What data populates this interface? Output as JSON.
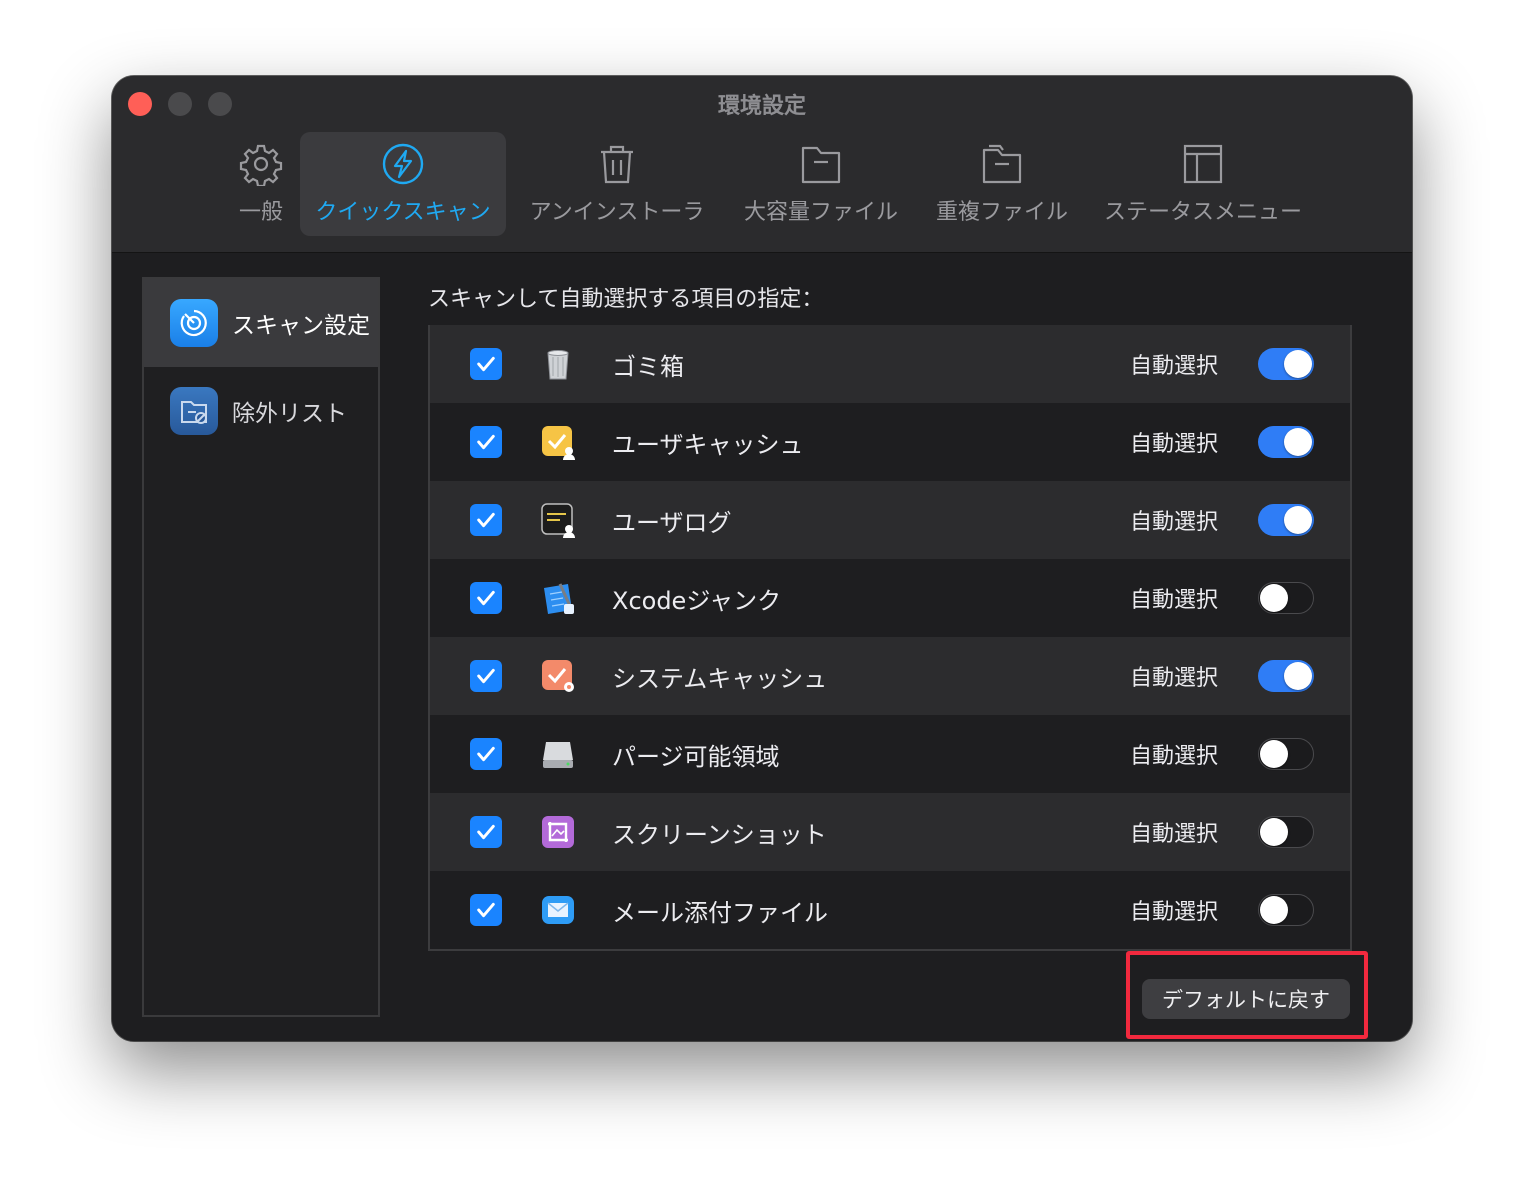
{
  "window": {
    "title": "環境設定"
  },
  "toolbar": {
    "tabs": [
      {
        "label": "一般",
        "icon": "gear-icon",
        "active": false
      },
      {
        "label": "クイックスキャン",
        "icon": "lightning-icon",
        "active": true
      },
      {
        "label": "アンインストーラ",
        "icon": "trash-icon",
        "active": false
      },
      {
        "label": "大容量ファイル",
        "icon": "folder-icon",
        "active": false
      },
      {
        "label": "重複ファイル",
        "icon": "folders-icon",
        "active": false
      },
      {
        "label": "ステータスメニュー",
        "icon": "layout-icon",
        "active": false
      }
    ]
  },
  "sidebar": {
    "items": [
      {
        "label": "スキャン設定",
        "icon": "scan-target-icon",
        "active": true
      },
      {
        "label": "除外リスト",
        "icon": "folder-exclude-icon",
        "active": false
      }
    ]
  },
  "main": {
    "section_title": "スキャンして自動選択する項目の指定：",
    "auto_label": "自動選択",
    "items": [
      {
        "label": "ゴミ箱",
        "icon": "trash-can-icon",
        "checked": true,
        "auto": true
      },
      {
        "label": "ユーザキャッシュ",
        "icon": "user-cache-icon",
        "checked": true,
        "auto": true
      },
      {
        "label": "ユーザログ",
        "icon": "user-log-icon",
        "checked": true,
        "auto": true
      },
      {
        "label": "Xcodeジャンク",
        "icon": "xcode-icon",
        "checked": true,
        "auto": false
      },
      {
        "label": "システムキャッシュ",
        "icon": "system-cache-icon",
        "checked": true,
        "auto": true
      },
      {
        "label": "パージ可能領域",
        "icon": "disk-icon",
        "checked": true,
        "auto": false
      },
      {
        "label": "スクリーンショット",
        "icon": "screenshot-icon",
        "checked": true,
        "auto": false
      },
      {
        "label": "メール添付ファイル",
        "icon": "mail-icon",
        "checked": true,
        "auto": false
      }
    ],
    "reset_label": "デフォルトに戻す"
  },
  "colors": {
    "accent": "#1fa9f2",
    "toggle_on": "#2f7df6",
    "highlight": "#f2293e"
  }
}
